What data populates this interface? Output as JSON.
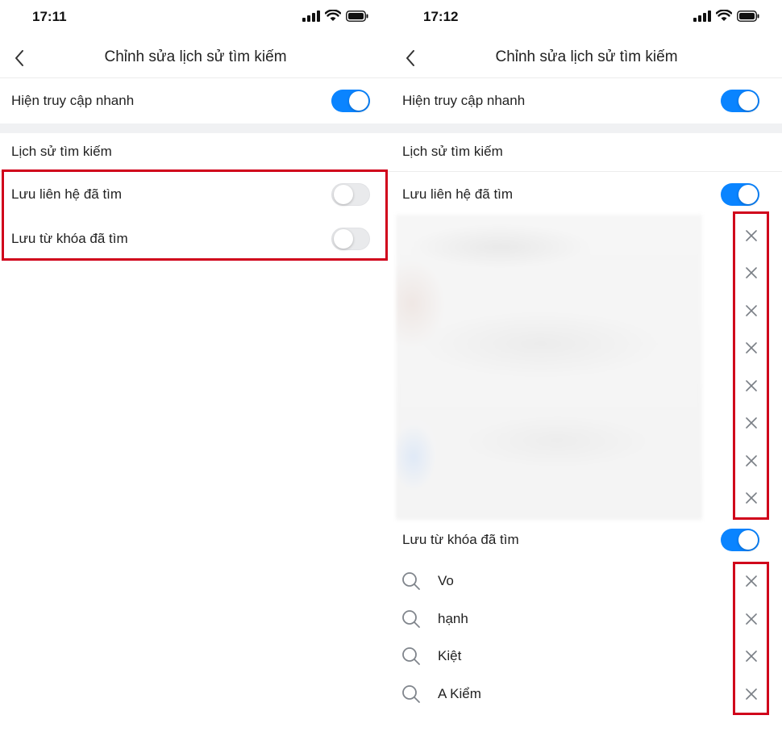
{
  "left": {
    "status": {
      "time": "17:11"
    },
    "nav": {
      "title": "Chỉnh sửa lịch sử tìm kiếm"
    },
    "quick_access": {
      "label": "Hiện truy cập nhanh",
      "enabled": true
    },
    "history": {
      "title": "Lịch sử tìm kiếm",
      "save_contacts": {
        "label": "Lưu liên hệ đã tìm",
        "enabled": false
      },
      "save_keywords": {
        "label": "Lưu từ khóa đã tìm",
        "enabled": false
      }
    }
  },
  "right": {
    "status": {
      "time": "17:12"
    },
    "nav": {
      "title": "Chỉnh sửa lịch sử tìm kiếm"
    },
    "quick_access": {
      "label": "Hiện truy cập nhanh",
      "enabled": true
    },
    "history": {
      "title": "Lịch sử tìm kiếm",
      "save_contacts": {
        "label": "Lưu liên hệ đã tìm",
        "enabled": true
      },
      "save_keywords": {
        "label": "Lưu từ khóa đã tìm",
        "enabled": true
      }
    },
    "keywords": [
      "Vo",
      "hạnh",
      "Kiệt",
      "A Kiểm"
    ]
  },
  "icons": {
    "back": "chevron-left-icon",
    "signal": "cellular-signal-icon",
    "wifi": "wifi-icon",
    "battery": "battery-icon",
    "remove": "close-icon",
    "search": "search-icon"
  },
  "colors": {
    "toggle_on": "#0a84ff",
    "toggle_off": "#e9eaec",
    "highlight": "#d0021b",
    "section_gap": "#f0f1f3"
  }
}
